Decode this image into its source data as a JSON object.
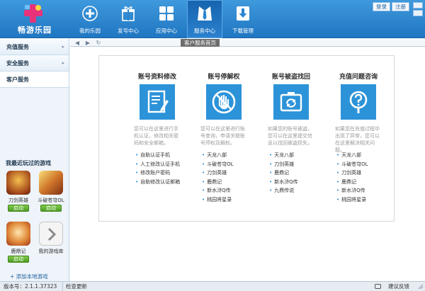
{
  "app": {
    "logo_text": "畅游乐园"
  },
  "nav": {
    "items": [
      {
        "label": "我的乐园"
      },
      {
        "label": "发号中心"
      },
      {
        "label": "应用中心"
      },
      {
        "label": "服务中心"
      },
      {
        "label": "下载管理"
      }
    ],
    "active_index": 3
  },
  "top_buttons": {
    "login": "登录",
    "register": "注册"
  },
  "sidebar": {
    "items": [
      {
        "label": "充值服务"
      },
      {
        "label": "安全服务"
      },
      {
        "label": "客户服务"
      }
    ],
    "recent_title": "我最近玩过的游戏",
    "games": [
      {
        "name": "刀剑英雄",
        "action": "启动"
      },
      {
        "name": "斗破苍穹OL",
        "action": "启动"
      },
      {
        "name": "鹿鼎记",
        "action": "启动"
      },
      {
        "name": "我的游戏库",
        "action": ""
      }
    ],
    "add_local": "+ 添加本地游戏"
  },
  "tab": {
    "label": "客户服务首页"
  },
  "columns": [
    {
      "title": "账号资料修改",
      "icon": "document-edit-icon",
      "desc": "您可以在这里进行手机认证，修改相关密码和安全邮箱。",
      "items": [
        "自助认证手机",
        "人工修改认证手机",
        "修改账户密码",
        "自助修改认证邮箱"
      ]
    },
    {
      "title": "账号停解权",
      "icon": "stop-hand-icon",
      "desc": "您可以在这里进行账号查询，申请关联账号停权及解权。",
      "items": [
        "天龙八部",
        "斗破苍穹OL",
        "刀剑英雄",
        "鹿鼎记",
        "新水浒Q传",
        "桃园将星录"
      ]
    },
    {
      "title": "账号被盗找回",
      "icon": "recover-icon",
      "desc": "如果您的账号被盗，您可以在这里提交信息以找回被盗损失。",
      "items": [
        "天龙八部",
        "刀剑英雄",
        "鹿鼎记",
        "新水浒Q传",
        "九鼎传说"
      ]
    },
    {
      "title": "充值问题咨询",
      "icon": "question-icon",
      "desc": "如果您在充值过程中出现了异常，您可以在这里解决相关问题。",
      "items": [
        "天龙八部",
        "斗破苍穹OL",
        "刀剑英雄",
        "鹿鼎记",
        "新水浒Q传",
        "桃园将星录"
      ]
    }
  ],
  "status": {
    "version": "版本号：2.1.1.37323",
    "check_update": "检查更新",
    "feedback": "建议反馈"
  },
  "colors": {
    "header": "#2a84cf",
    "accent": "#2c93d9",
    "start_button": "#5aa82c"
  }
}
